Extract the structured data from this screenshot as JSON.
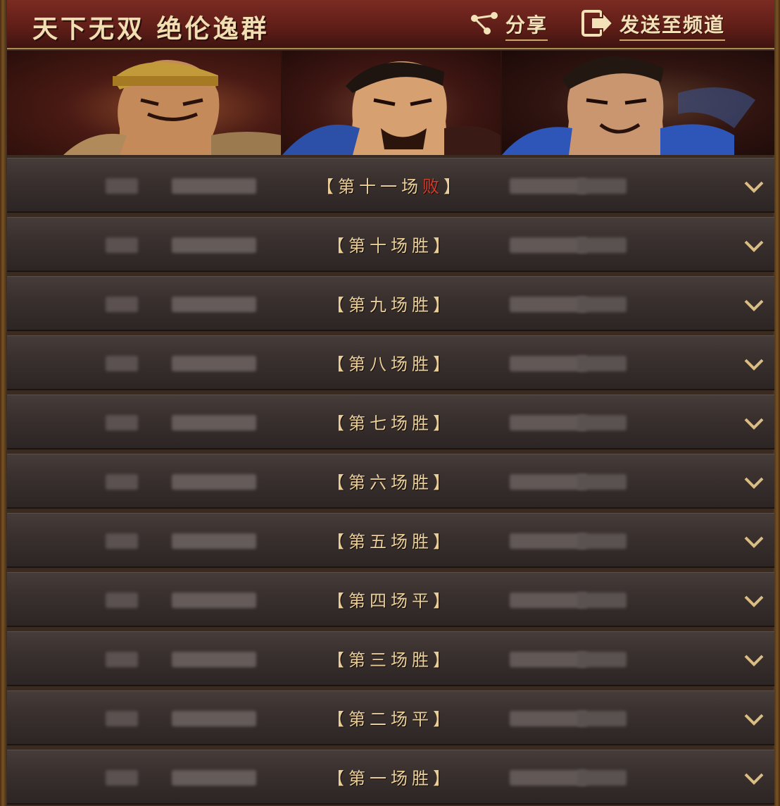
{
  "header": {
    "title": "天下无双 绝伦逸群",
    "share_label": "分享",
    "send_label": "发送至频道"
  },
  "rows": [
    {
      "prefix": "第十一场",
      "result": "败"
    },
    {
      "prefix": "第十场",
      "result": "胜"
    },
    {
      "prefix": "第九场",
      "result": "胜"
    },
    {
      "prefix": "第八场",
      "result": "胜"
    },
    {
      "prefix": "第七场",
      "result": "胜"
    },
    {
      "prefix": "第六场",
      "result": "胜"
    },
    {
      "prefix": "第五场",
      "result": "胜"
    },
    {
      "prefix": "第四场",
      "result": "平"
    },
    {
      "prefix": "第三场",
      "result": "胜"
    },
    {
      "prefix": "第二场",
      "result": "平"
    },
    {
      "prefix": "第一场",
      "result": "胜"
    }
  ],
  "colors": {
    "lose": "#d23a2a",
    "gold": "#e9cf97"
  }
}
